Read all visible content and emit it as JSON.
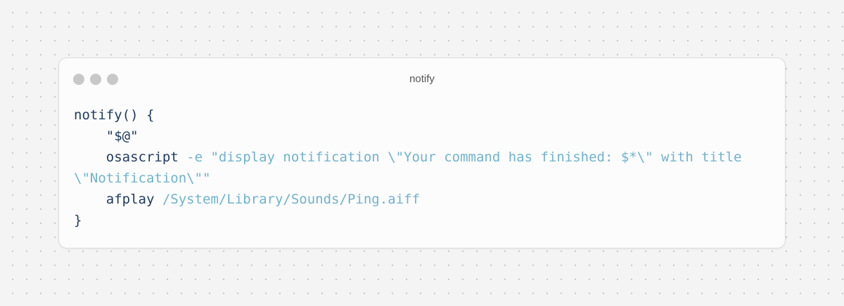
{
  "window": {
    "title": "notify",
    "controls": [
      "close-dot",
      "minimize-dot",
      "maximize-dot"
    ]
  },
  "code": {
    "lines": [
      [
        {
          "text": "notify() {",
          "kind": "plain"
        }
      ],
      [
        {
          "text": "    \"$@\"",
          "kind": "plain"
        }
      ],
      [
        {
          "text": "    osascript ",
          "kind": "plain"
        },
        {
          "text": "-e \"display notification \\\"Your command has finished: $*\\\" with title \\\"Notification\\\"\"",
          "kind": "arg"
        }
      ],
      [
        {
          "text": "    afplay ",
          "kind": "plain"
        },
        {
          "text": "/System/Library/Sounds/Ping.aiff",
          "kind": "arg"
        }
      ],
      [
        {
          "text": "}",
          "kind": "plain"
        }
      ]
    ]
  },
  "colors": {
    "background": "#f4f4f4",
    "window": "#fcfcfc",
    "dot": "#c8c8c8",
    "code_plain": "#1e3a5f",
    "code_arg": "#6fb3cf"
  }
}
